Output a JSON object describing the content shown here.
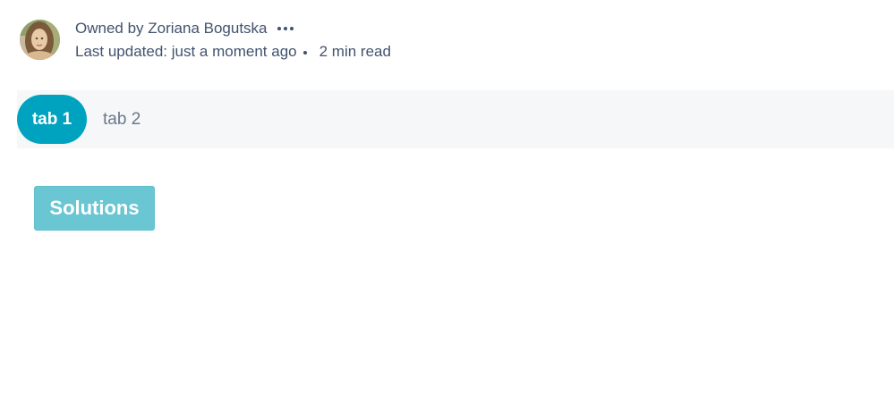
{
  "byline": {
    "owner_text": "Owned by Zoriana Bogutska",
    "last_updated": "Last updated: just a moment ago",
    "read_time": "2 min read",
    "more_icon": "more-horizontal-icon"
  },
  "tabs": [
    {
      "label": "tab 1",
      "active": true
    },
    {
      "label": "tab 2",
      "active": false
    }
  ],
  "content": {
    "button_label": "Solutions"
  },
  "colors": {
    "accent": "#00a3bf",
    "button": "#6ac6d2",
    "tab_bar_bg": "#f5f7f8",
    "text": "#42526e"
  }
}
